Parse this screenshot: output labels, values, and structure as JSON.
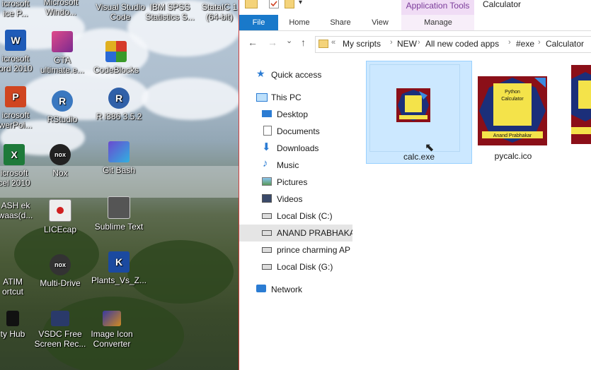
{
  "desktop": {
    "icons": [
      {
        "label": "icrosoft\nice P...",
        "color": "#c44a1a",
        "glyph": ""
      },
      {
        "label": "Microsoft\nWindo...",
        "color": "#2e6bd6",
        "glyph": ""
      },
      {
        "label": "Visual Studio\nCode",
        "color": "#2378c7",
        "glyph": ""
      },
      {
        "label": "IBM SPSS\nStatistics S...",
        "color": "#b02020",
        "glyph": ""
      },
      {
        "label": "StataIC 1\n(64-bit)",
        "color": "#2a3a90",
        "glyph": ""
      },
      {
        "label": "icrosoft\nord 2010",
        "color": "#1f5bb8",
        "glyph": "W"
      },
      {
        "label": "GTA\nultimate.e...",
        "color": "#b03070",
        "glyph": ""
      },
      {
        "label": "CodeBlocks",
        "color": "#5a9a30",
        "glyph": ""
      },
      {
        "label": "icrosoft\nwerPoi...",
        "color": "#d04520",
        "glyph": "P"
      },
      {
        "label": "RStudio",
        "color": "#3a78c0",
        "glyph": "R"
      },
      {
        "label": "R i386 3.5.2",
        "color": "#3060a8",
        "glyph": "R"
      },
      {
        "label": "icrosoft\ncel 2010",
        "color": "#1e7a3a",
        "glyph": "X"
      },
      {
        "label": "Nox",
        "color": "#222222",
        "glyph": "nox"
      },
      {
        "label": "Git Bash",
        "color": "#6a4ad0",
        "glyph": ""
      },
      {
        "label": "ASH ek\nwaas(d...",
        "color": "#2a8ad8",
        "glyph": ""
      },
      {
        "label": "LICEcap",
        "color": "#c02020",
        "glyph": ""
      },
      {
        "label": "Sublime Text",
        "color": "#555555",
        "glyph": ""
      },
      {
        "label": "ATIM\nortcut",
        "color": "#2a8ad8",
        "glyph": ""
      },
      {
        "label": "Multi-Drive",
        "color": "#333333",
        "glyph": "nox"
      },
      {
        "label": "Plants_Vs_Z...",
        "color": "#1b4aa0",
        "glyph": "K"
      },
      {
        "label": "ty Hub",
        "color": "#111111",
        "glyph": ""
      },
      {
        "label": "VSDC Free\nScreen Rec...",
        "color": "#2a3a6a",
        "glyph": ""
      },
      {
        "label": "Image Icon\nConverter",
        "color": "#d08a20",
        "glyph": ""
      }
    ]
  },
  "explorer": {
    "app_tools_label": "Application Tools",
    "window_title": "Calculator",
    "tabs": {
      "file": "File",
      "home": "Home",
      "share": "Share",
      "view": "View",
      "manage": "Manage"
    },
    "nav_buttons": {
      "back": "←",
      "forward": "→",
      "recent": "⌄",
      "up": "↑"
    },
    "breadcrumb": {
      "overflow": "«",
      "items": [
        "My scripts",
        "NEW",
        "All new coded apps",
        "#exe",
        "Calculator"
      ]
    },
    "nav_pane": [
      {
        "label": "Quick access",
        "icon": "star-icon",
        "color": "#2b7cd3"
      },
      {
        "label": "This PC",
        "icon": "computer-icon",
        "color": "#2b7cd3"
      },
      {
        "label": "Desktop",
        "icon": "desktop-icon",
        "color": "#2b7cd3"
      },
      {
        "label": "Documents",
        "icon": "documents-icon",
        "color": "#666666"
      },
      {
        "label": "Downloads",
        "icon": "downloads-icon",
        "color": "#2b7cd3"
      },
      {
        "label": "Music",
        "icon": "music-icon",
        "color": "#2b7cd3"
      },
      {
        "label": "Pictures",
        "icon": "pictures-icon",
        "color": "#666666"
      },
      {
        "label": "Videos",
        "icon": "videos-icon",
        "color": "#666666"
      },
      {
        "label": "Local Disk (C:)",
        "icon": "drive-icon",
        "color": "#444444"
      },
      {
        "label": "ANAND PRABHAKAR",
        "icon": "drive-icon",
        "color": "#444444"
      },
      {
        "label": "prince charming AP",
        "icon": "drive-icon",
        "color": "#444444"
      },
      {
        "label": "Local Disk (G:)",
        "icon": "drive-icon",
        "color": "#444444"
      },
      {
        "label": "Network",
        "icon": "network-icon",
        "color": "#2b7cd3"
      }
    ],
    "files": [
      {
        "name": "calc.exe"
      },
      {
        "name": "pycalc.ico"
      },
      {
        "name": ""
      }
    ],
    "colors": {
      "file_tab": "#1979ca",
      "selection": "#cce8ff",
      "nav_highlight": "#e5e5e5"
    }
  }
}
